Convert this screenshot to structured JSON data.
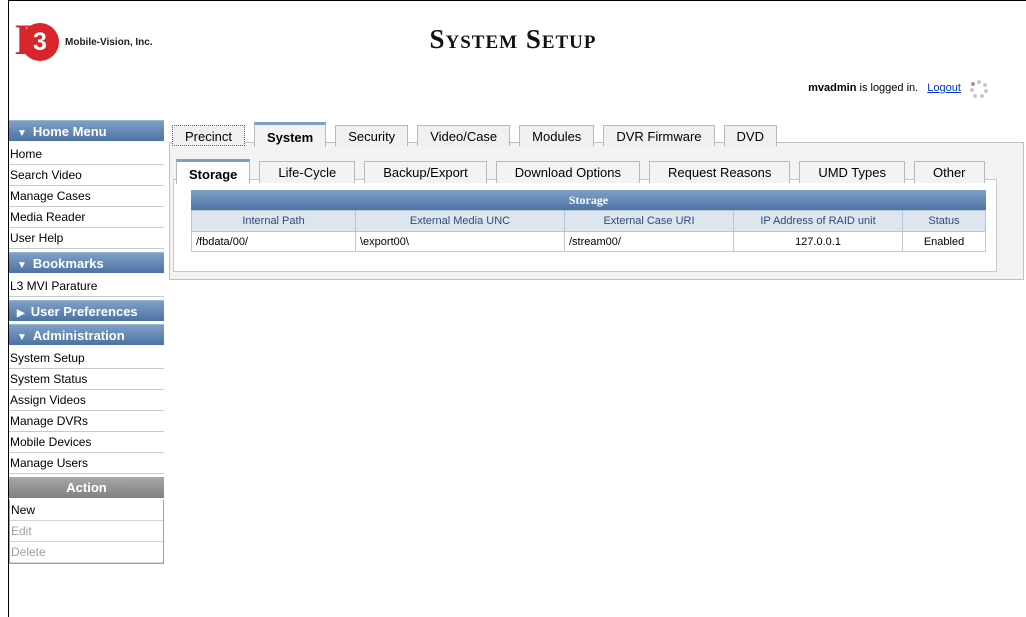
{
  "brand": {
    "logo_mark": "L",
    "logo_num": "3",
    "company": "Mobile-Vision, Inc."
  },
  "page_title": "System Setup",
  "session": {
    "user": "mvadmin",
    "status_text": "is logged in.",
    "logout_label": "Logout"
  },
  "sidebar": {
    "home_menu": {
      "title": "Home Menu",
      "items": [
        "Home",
        "Search Video",
        "Manage Cases",
        "Media Reader",
        "User Help"
      ]
    },
    "bookmarks": {
      "title": "Bookmarks",
      "items": [
        "L3 MVI Parature"
      ]
    },
    "user_prefs": {
      "title": "User Preferences"
    },
    "administration": {
      "title": "Administration",
      "items": [
        "System Setup",
        "System Status",
        "Assign Videos",
        "Manage DVRs",
        "Mobile Devices",
        "Manage Users"
      ]
    },
    "action": {
      "title": "Action",
      "items": [
        "New",
        "Edit",
        "Delete"
      ]
    }
  },
  "main_tabs": [
    "Precinct",
    "System",
    "Security",
    "Video/Case",
    "Modules",
    "DVR Firmware",
    "DVD"
  ],
  "sub_tabs": [
    "Storage",
    "Life-Cycle",
    "Backup/Export",
    "Download Options",
    "Request Reasons",
    "UMD Types",
    "Other"
  ],
  "storage_table": {
    "caption": "Storage",
    "headers": [
      "Internal Path",
      "External Media UNC",
      "External Case URI",
      "IP Address of RAID unit",
      "Status"
    ],
    "rows": [
      [
        "/fbdata/00/",
        "\\export00\\",
        "/stream00/",
        "127.0.0.1",
        "Enabled"
      ]
    ]
  },
  "colors": {
    "header_blue": "#4c73a4",
    "logo_red": "#d8242b",
    "link_blue": "#0033cc"
  }
}
